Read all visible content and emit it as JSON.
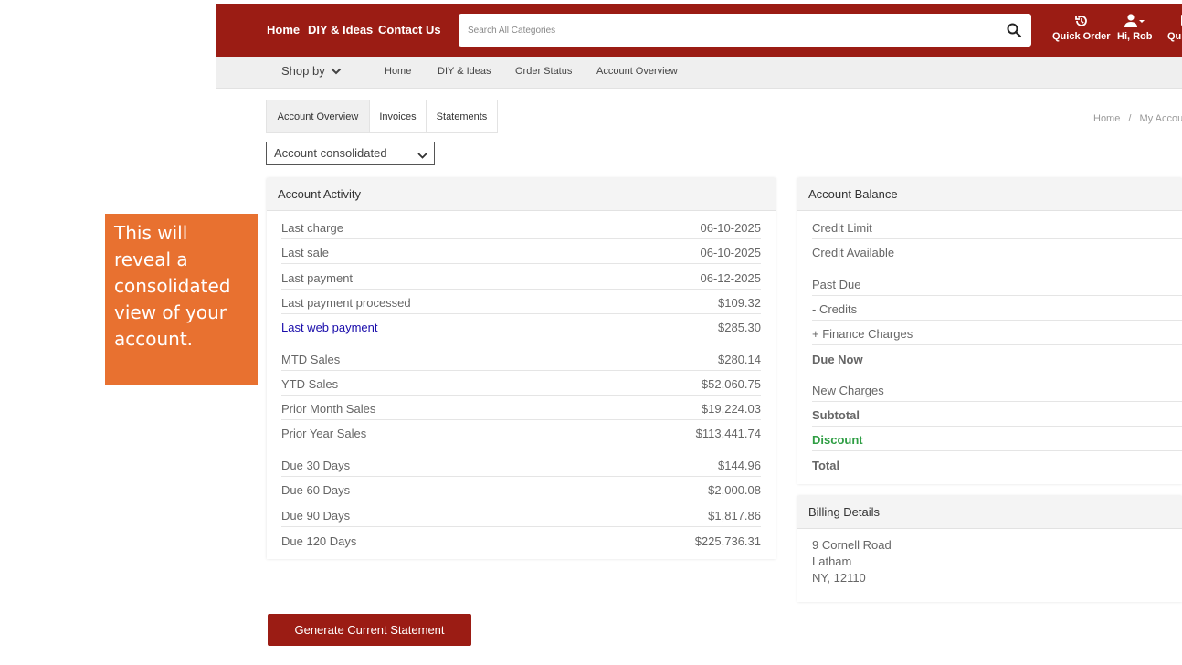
{
  "header": {
    "nav": [
      "Home",
      "DIY & Ideas",
      "Contact Us"
    ],
    "search_placeholder": "Search All Categories",
    "tools": [
      {
        "label": "Quick Order",
        "icon": "history-icon"
      },
      {
        "label": "Hi, Rob",
        "icon": "user-icon"
      },
      {
        "label": "Quic",
        "icon": "quick-icon"
      }
    ]
  },
  "subnav": {
    "shop_by": "Shop by",
    "items": [
      "Home",
      "DIY & Ideas",
      "Order Status",
      "Account Overview"
    ]
  },
  "tabs": [
    "Account Overview",
    "Invoices",
    "Statements"
  ],
  "breadcrumb": [
    "Home",
    "/",
    "My Accou"
  ],
  "account_select": "Account consolidated",
  "callout": "This will reveal a consolidated view of your account.",
  "activity": {
    "title": "Account Activity",
    "rows": [
      {
        "label": "Last charge",
        "value": "06-10-2025"
      },
      {
        "label": "Last sale",
        "value": "06-10-2025"
      },
      {
        "label": "Last payment",
        "value": "06-12-2025"
      },
      {
        "label": "Last payment processed",
        "value": "$109.32"
      },
      {
        "label": "Last web payment",
        "value": "$285.30"
      },
      {
        "label": "MTD Sales",
        "value": "$280.14"
      },
      {
        "label": "YTD Sales",
        "value": "$52,060.75"
      },
      {
        "label": "Prior Month Sales",
        "value": "$19,224.03"
      },
      {
        "label": "Prior Year Sales",
        "value": "$113,441.74"
      },
      {
        "label": "Due 30 Days",
        "value": "$144.96"
      },
      {
        "label": "Due 60 Days",
        "value": "$2,000.08"
      },
      {
        "label": "Due 90 Days",
        "value": "$1,817.86"
      },
      {
        "label": "Due 120 Days",
        "value": "$225,736.31"
      }
    ]
  },
  "balance": {
    "title": "Account Balance",
    "rows": [
      {
        "label": "Credit Limit"
      },
      {
        "label": "Credit Available"
      },
      {
        "label": "Past Due"
      },
      {
        "label": "- Credits"
      },
      {
        "label": "+ Finance Charges"
      },
      {
        "label": "Due Now"
      },
      {
        "label": "New Charges"
      },
      {
        "label": "Subtotal"
      },
      {
        "label": "Discount"
      },
      {
        "label": "Total"
      }
    ]
  },
  "billing": {
    "title": "Billing Details",
    "lines": [
      "9 Cornell Road",
      "Latham",
      "NY, 12110"
    ]
  },
  "generate_button": "Generate Current Statement",
  "colors": {
    "brand": "#9b1c14",
    "callout": "#e87130",
    "discount": "#2f9e44",
    "link": "#1a0dab"
  }
}
